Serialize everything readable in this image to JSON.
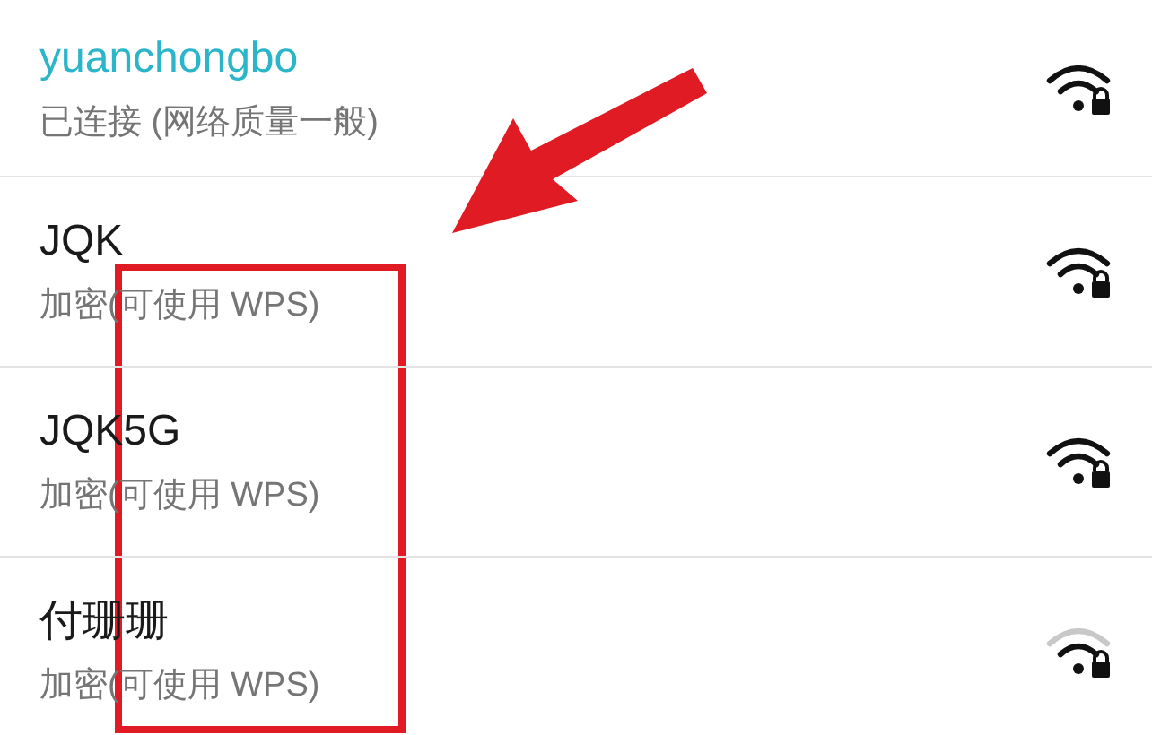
{
  "networks": [
    {
      "name": "yuanchongbo",
      "status": "已连接 (网络质量一般)",
      "connected": true,
      "weak": false
    },
    {
      "name": "JQK",
      "status": "加密(可使用 WPS)",
      "connected": false,
      "weak": false
    },
    {
      "name": "JQK5G",
      "status": "加密(可使用 WPS)",
      "connected": false,
      "weak": false
    },
    {
      "name": "付珊珊",
      "status": "加密(可使用 WPS)",
      "connected": false,
      "weak": true
    }
  ]
}
